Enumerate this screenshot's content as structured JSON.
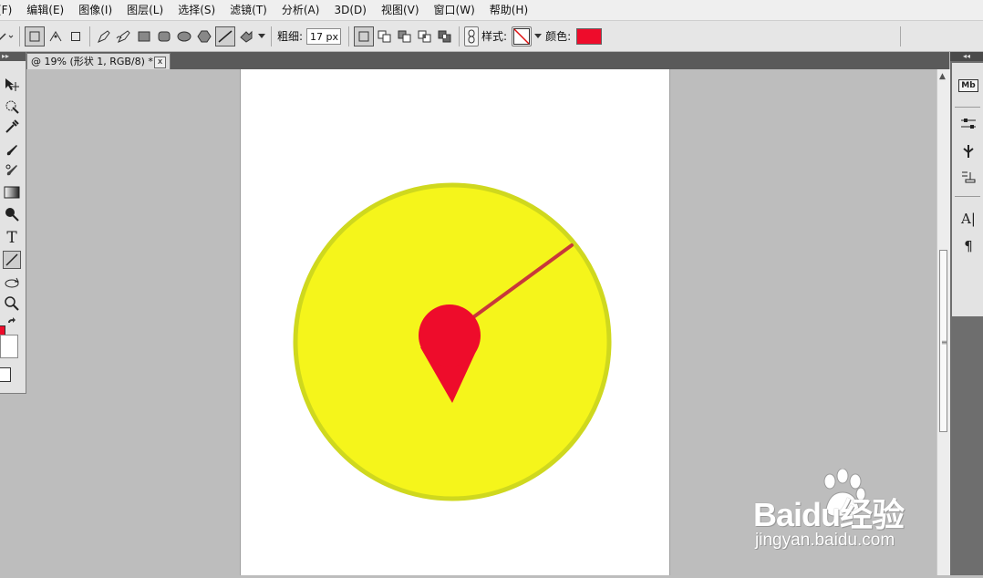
{
  "menu": [
    "(F)",
    "编辑(E)",
    "图像(I)",
    "图层(L)",
    "选择(S)",
    "滤镜(T)",
    "分析(A)",
    "3D(D)",
    "视图(V)",
    "窗口(W)",
    "帮助(H)"
  ],
  "options": {
    "weight_label": "粗细:",
    "weight_value": "17 px",
    "style_label": "样式:",
    "color_label": "颜色:",
    "fill_color": "#ee0c2b"
  },
  "document": {
    "tab_title": "@ 19% (形状 1, RGB/8) *",
    "tab_close": "x"
  },
  "tools": {
    "text_tool_glyph": "T"
  },
  "right_panel": {
    "mb_label": "Mb",
    "char_glyph": "A|",
    "para_glyph": "¶"
  },
  "artwork": {
    "circle_fill": "#f5f51b",
    "circle_stroke": "#cfd81e",
    "pin_color": "#ee0c2b",
    "line_color": "#c8383a"
  },
  "watermark": {
    "brand": "Baidu经验",
    "url": "jingyan.baidu.com"
  }
}
